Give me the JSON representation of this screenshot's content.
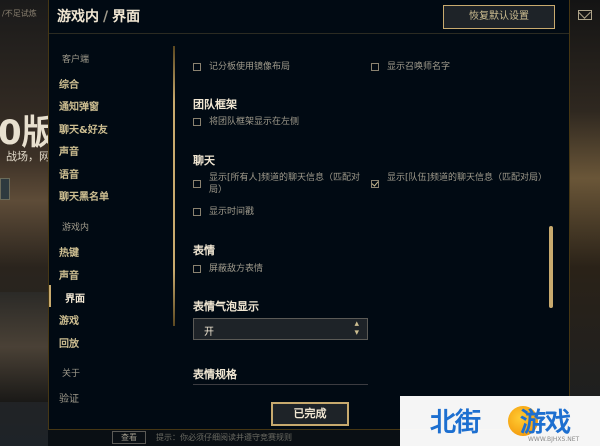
{
  "background": {
    "top_text": "/不足试炼",
    "big_text": "0版",
    "sub_text": "战场，网",
    "bottom_button": "查看",
    "bottom_text": "提示：你必须仔细阅读并遵守竞赛规则"
  },
  "header": {
    "crumb_section": "游戏内",
    "crumb_separator": "/",
    "crumb_page": "界面",
    "reset_button": "恢复默认设置"
  },
  "sidebar": {
    "groups": [
      {
        "label": "客户端",
        "items": [
          "综合",
          "通知弹窗",
          "聊天&好友",
          "声音",
          "语音",
          "聊天黑名单"
        ]
      },
      {
        "label": "游戏内",
        "items": [
          "热键",
          "声音",
          "界面",
          "游戏",
          "回放"
        ]
      },
      {
        "label": "关于",
        "items": [
          "验证"
        ]
      }
    ],
    "active_item": "界面"
  },
  "content": {
    "row1_left": "记分板使用镜像布局",
    "row1_right": "显示召唤师名字",
    "team_frame": {
      "title": "团队框架",
      "option": "将团队框架显示在左侧"
    },
    "chat": {
      "title": "聊天",
      "opt_all": "显示[所有人]频道的聊天信息（匹配对局）",
      "opt_team": "显示[队伍]频道的聊天信息（匹配对局）",
      "opt_time": "显示时间戳"
    },
    "emotes": {
      "title": "表情",
      "option": "屏蔽敌方表情"
    },
    "emote_bubble": {
      "title": "表情气泡显示",
      "value": "开"
    },
    "emote_size": {
      "title": "表情规格"
    }
  },
  "footer": {
    "done_button": "已完成"
  },
  "watermark": {
    "text_left": "北街",
    "text_right": "游戏",
    "url": "WWW.BJHXS.NET"
  },
  "colors": {
    "gold": "#c8aa6e",
    "panel_bg": "#010a13",
    "text_light": "#f0e6d2",
    "text_muted": "#a09b8c"
  }
}
